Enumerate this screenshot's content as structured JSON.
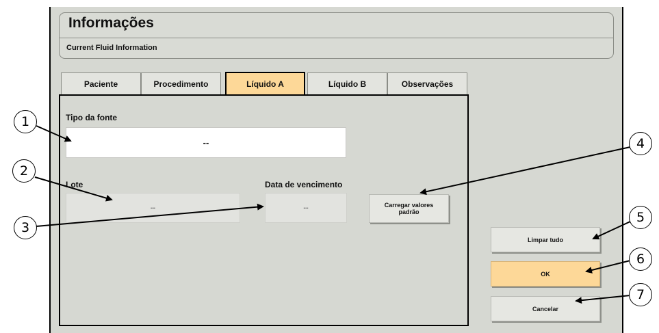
{
  "header": {
    "title": "Informações",
    "subtitle": "Current Fluid Information"
  },
  "tabs": [
    {
      "label": "Paciente",
      "active": false
    },
    {
      "label": "Procedimento",
      "active": false
    },
    {
      "label": "Líquido A",
      "active": true
    },
    {
      "label": "Líquido B",
      "active": false
    },
    {
      "label": "Observações",
      "active": false
    }
  ],
  "form": {
    "source_type_label": "Tipo da fonte",
    "source_type_value": "--",
    "lot_label": "Lote",
    "lot_value": "--",
    "expiry_label": "Data de vencimento",
    "expiry_value": "--",
    "load_defaults_label": "Carregar valores padrão"
  },
  "actions": {
    "clear_all_label": "Limpar tudo",
    "ok_label": "OK",
    "cancel_label": "Cancelar"
  },
  "callouts": [
    "1",
    "2",
    "3",
    "4",
    "5",
    "6",
    "7"
  ],
  "colors": {
    "background": "#d6d8d2",
    "active_tab": "#fdd898",
    "ok_button": "#fdd898"
  }
}
